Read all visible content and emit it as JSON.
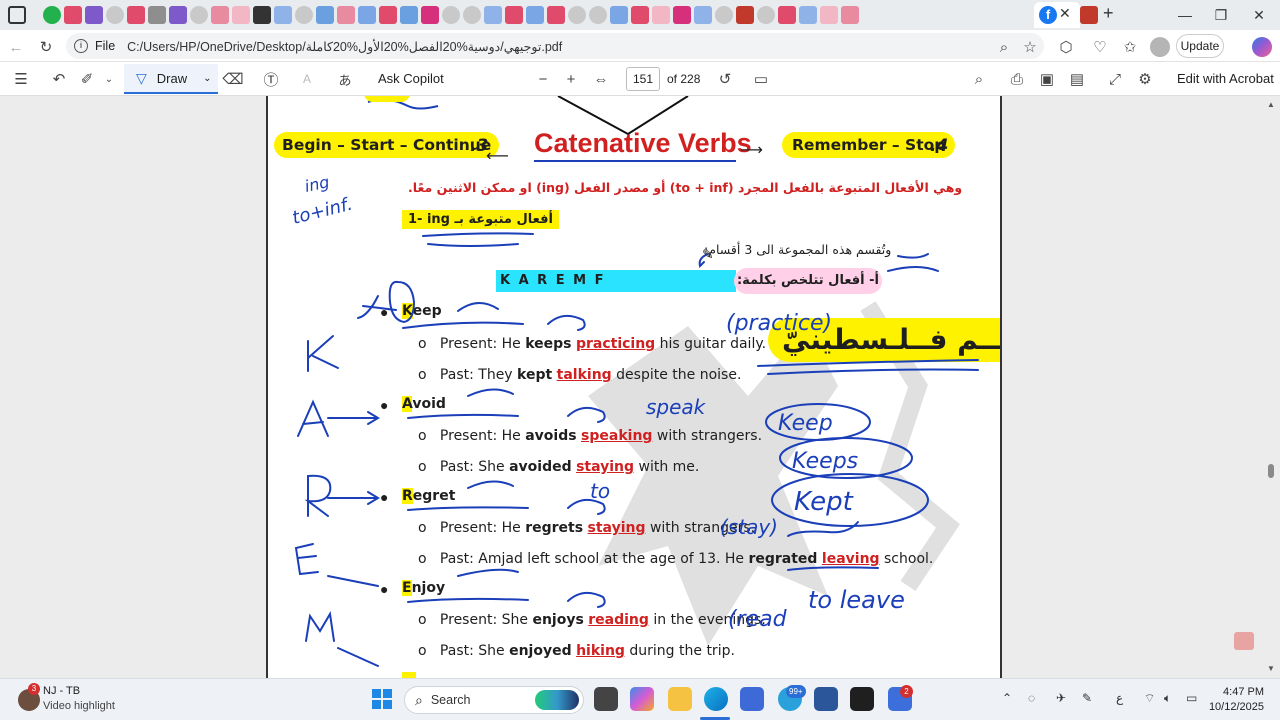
{
  "browser": {
    "file_label": "File",
    "url": "C:/Users/HP/OneDrive/Desktop/توجيهي/دوسية%20الفصل%20الأول%20كاملة.pdf",
    "update_label": "Update"
  },
  "pdf_toolbar": {
    "draw_label": "Draw",
    "copilot_label": "Ask Copilot",
    "page_number": "151",
    "page_total": "of 228",
    "acrobat_label": "Edit with Acrobat"
  },
  "doc": {
    "left_box": "Begin – Start – Continue",
    "left_num": ".3",
    "title": "Catenative Verbs",
    "right_box": "Remember – Stop",
    "right_num": ".4",
    "arabic_intro": "وهي الأفعال المتبوعة بالفعل المجرد (to + inf) أو مصدر الفعل (ing) او ممكن الاثنين معًا.",
    "section_label": "1-  ing أفعال متبوعة بـ",
    "divided_note": "وتُقسم هذه المجموعة الى 3 أقسام:",
    "mnemonic_letters": "K    A    R    E    M    F",
    "mnemonic_label": "أ-   أفعال تتلخص بكلمة:",
    "mnemonic_word": "كــريــم فــلـسطينيّ",
    "verbs": [
      {
        "head_letter": "K",
        "head_rest": "eep",
        "ex1_pre": "Present: He ",
        "ex1_verb": "keeps",
        "ex1_ing": "practicing",
        "ex1_post": " his guitar daily.",
        "ex2_pre": "Past: They ",
        "ex2_verb": "kept",
        "ex2_ing": "talking",
        "ex2_post": " despite the noise."
      },
      {
        "head_letter": "A",
        "head_rest": "void",
        "ex1_pre": "Present: He ",
        "ex1_verb": "avoids",
        "ex1_ing": "speaking",
        "ex1_post": " with strangers.",
        "ex2_pre": "Past: She ",
        "ex2_verb": "avoided",
        "ex2_ing": "staying",
        "ex2_post": " with me."
      },
      {
        "head_letter": "R",
        "head_rest": "egret",
        "ex1_pre": "Present: He ",
        "ex1_verb": "regrets",
        "ex1_ing": "staying",
        "ex1_post": " with strangers.",
        "ex2_pre": "Past: Amjad left school at the age of 13. He ",
        "ex2_verb": "regrated",
        "ex2_ing": "leaving",
        "ex2_post": " school."
      },
      {
        "head_letter": "E",
        "head_rest": "njoy",
        "ex1_pre": "Present: She ",
        "ex1_verb": "enjoys",
        "ex1_ing": "reading",
        "ex1_post": " in the evenings.",
        "ex2_pre": "Past: She ",
        "ex2_verb": "enjoyed",
        "ex2_ing": "hiking",
        "ex2_post": " during the trip."
      }
    ],
    "handwriting": {
      "practice": "(practice)",
      "speak": "speak",
      "to": "to",
      "stay": "(stay)",
      "read": "(read",
      "to_leave": "to leave",
      "keep": "Keep",
      "keeps": "Keeps",
      "kept": "Kept",
      "ing_note": "ing",
      "to_inf_note": "to+inf."
    }
  },
  "taskbar": {
    "widget_title": "NJ - TB",
    "widget_sub": "Video highlight",
    "widget_badge": "3",
    "search_label": "Search",
    "badge_99": "99+",
    "badge_2": "2",
    "lang": "ع",
    "time": "4:47 PM",
    "date": "10/12/2025"
  },
  "colors": {
    "highlight_yellow": "#fff200",
    "cyan_band": "#29e3ff",
    "pink_band": "#ffd0e8",
    "red_text": "#d02020",
    "ink_blue": "#1a3fb8"
  }
}
